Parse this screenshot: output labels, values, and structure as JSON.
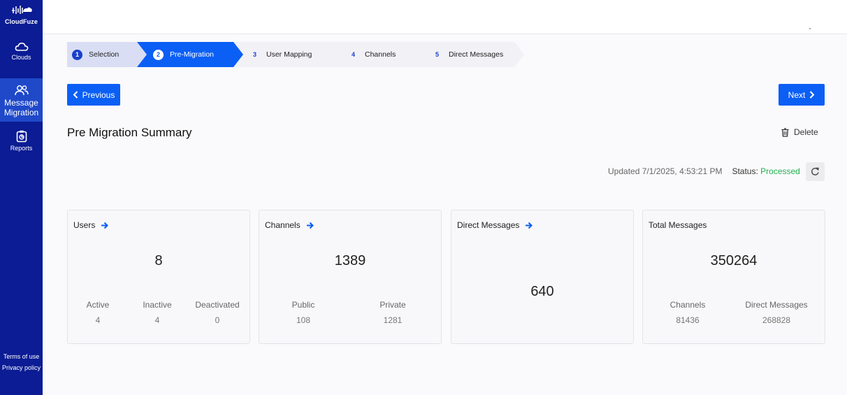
{
  "sidebar": {
    "logo_text": "CloudFuze",
    "items": [
      {
        "label": "Clouds",
        "icon": "cloud-icon"
      },
      {
        "label": "Message Migration",
        "icon": "users-icon"
      },
      {
        "label": "Reports",
        "icon": "report-icon"
      }
    ],
    "terms": "Terms of use",
    "privacy": "Privacy policy"
  },
  "stepper": {
    "steps": [
      {
        "num": "1",
        "label": "Selection",
        "state": "done"
      },
      {
        "num": "2",
        "label": "Pre-Migration",
        "state": "active"
      },
      {
        "num": "3",
        "label": "User Mapping",
        "state": "pending"
      },
      {
        "num": "4",
        "label": "Channels",
        "state": "pending"
      },
      {
        "num": "5",
        "label": "Direct Messages",
        "state": "pending"
      }
    ]
  },
  "nav": {
    "previous": "Previous",
    "next": "Next"
  },
  "summary": {
    "title": "Pre Migration Summary",
    "delete": "Delete",
    "updated": "Updated 7/1/2025, 4:53:21 PM",
    "status_label": "Status:",
    "status_value": "Processed"
  },
  "cards": {
    "users": {
      "title": "Users",
      "total": "8",
      "active_label": "Active",
      "active": "4",
      "inactive_label": "Inactive",
      "inactive": "4",
      "deactivated_label": "Deactivated",
      "deactivated": "0"
    },
    "channels": {
      "title": "Channels",
      "total": "1389",
      "public_label": "Public",
      "public": "108",
      "private_label": "Private",
      "private": "1281"
    },
    "dms": {
      "title": "Direct Messages",
      "total": "640"
    },
    "total": {
      "title": "Total Messages",
      "total": "350264",
      "channels_label": "Channels",
      "channels": "81436",
      "dm_label": "Direct Messages",
      "dm": "268828"
    }
  },
  "colors": {
    "sidebar": "#0b1c94",
    "active_nav": "#1f49c9",
    "primary": "#0b5ff5",
    "status_ok": "#22b14c"
  }
}
